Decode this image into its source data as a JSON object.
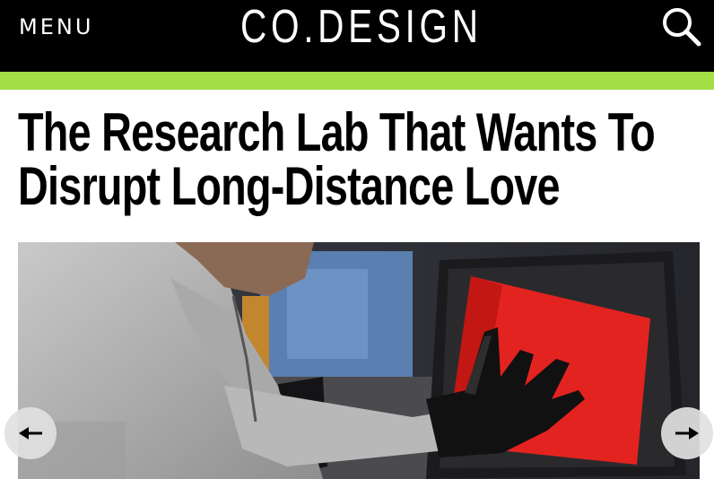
{
  "header": {
    "menu_label": "MENU",
    "logo_text": "CO.DESIGN",
    "search_icon": "search-icon",
    "accent_color": "#a3de46",
    "background_color": "#000000"
  },
  "article": {
    "headline_line1": "The Research Lab That Wants To",
    "headline_line2": "Disrupt Long-Distance Love"
  },
  "gallery": {
    "prev_icon": "arrow-left-icon",
    "next_icon": "arrow-right-icon"
  }
}
